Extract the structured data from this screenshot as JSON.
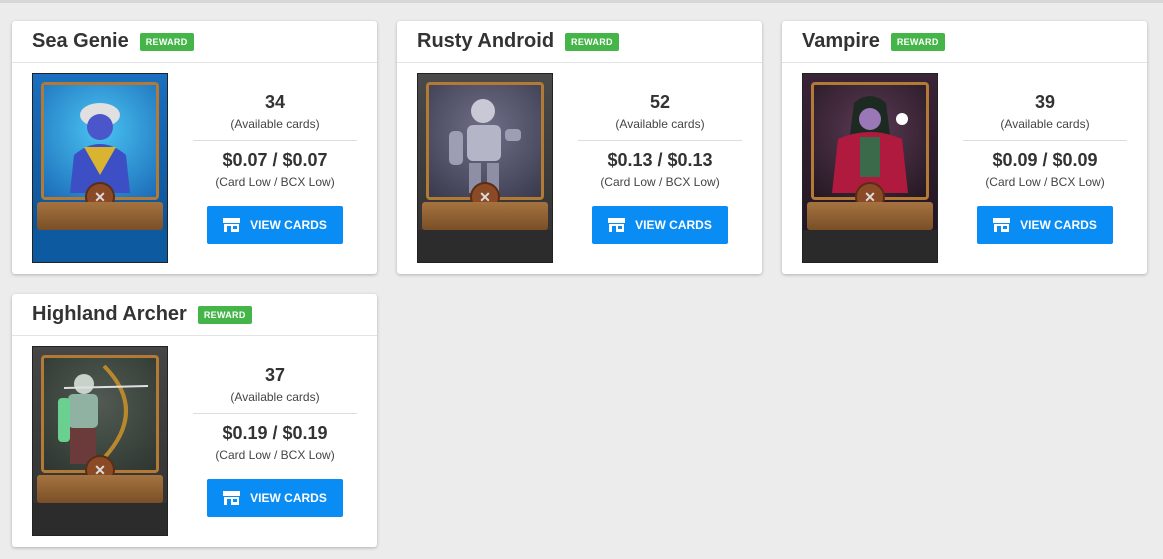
{
  "cards": [
    {
      "name": "Sea Genie",
      "badge": "REWARD",
      "available": "34",
      "available_label": "(Available cards)",
      "price": "$0.07 / $0.07",
      "price_label": "(Card Low / BCX Low)",
      "button_label": "VIEW CARDS",
      "art_bg": "#1a78c2",
      "art_frame": "#b27a35"
    },
    {
      "name": "Rusty Android",
      "badge": "REWARD",
      "available": "52",
      "available_label": "(Available cards)",
      "price": "$0.13 / $0.13",
      "price_label": "(Card Low / BCX Low)",
      "button_label": "VIEW CARDS",
      "art_bg": "#3f3f3f",
      "art_frame": "#b27a35"
    },
    {
      "name": "Vampire",
      "badge": "REWARD",
      "available": "39",
      "available_label": "(Available cards)",
      "price": "$0.09 / $0.09",
      "price_label": "(Card Low / BCX Low)",
      "button_label": "VIEW CARDS",
      "art_bg": "#2b1f2a",
      "art_frame": "#b27a35"
    },
    {
      "name": "Highland Archer",
      "badge": "REWARD",
      "available": "37",
      "available_label": "(Available cards)",
      "price": "$0.19 / $0.19",
      "price_label": "(Card Low / BCX Low)",
      "button_label": "VIEW CARDS",
      "art_bg": "#3d3d3d",
      "art_frame": "#b27a35"
    }
  ],
  "icons": {
    "button_icon": "store-icon",
    "orb_icon": "element-orb-icon"
  },
  "colors": {
    "reward_badge": "#45b549",
    "button": "#0a8cf5",
    "page_bg": "#ececec"
  }
}
